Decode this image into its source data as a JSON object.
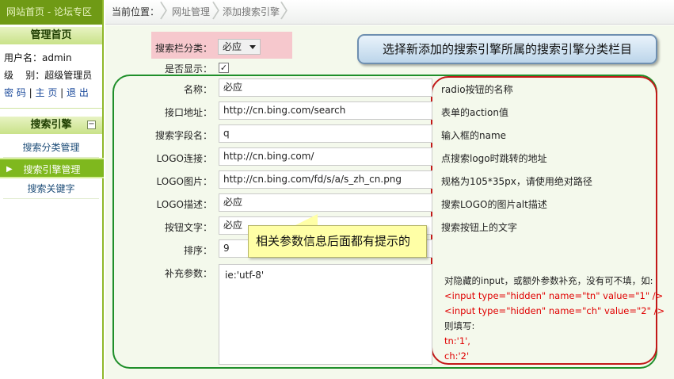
{
  "topnav": {
    "text": "网站首页 - 论坛专区"
  },
  "sidebar": {
    "section1_title": "管理首页",
    "username_label": "用户名：",
    "username": "admin",
    "level_label": "级    别：",
    "level": "超级管理员",
    "link_password": "密 码",
    "link_home": "主 页",
    "link_logout": "退 出",
    "section2_title": "搜索引擎",
    "collapse_icon": "minus-box-icon",
    "items": [
      {
        "label": "搜索分类管理"
      },
      {
        "label": "搜索引擎管理"
      },
      {
        "label": "搜索关键字"
      }
    ]
  },
  "breadcrumb": {
    "current_label": "当前位置：",
    "level1": "网址管理",
    "level2": "添加搜索引擎"
  },
  "form": {
    "category_label": "搜索栏分类：",
    "category_value": "必应",
    "show_label": "是否显示：",
    "show_checked": true,
    "fields": [
      {
        "label": "名称：",
        "value": "必应",
        "hint": "radio按钮的名称"
      },
      {
        "label": "接口地址：",
        "value": "http://cn.bing.com/search",
        "hint": "表单的action值"
      },
      {
        "label": "搜索字段名：",
        "value": "q",
        "hint": "输入框的name"
      },
      {
        "label": "LOGO连接：",
        "value": "http://cn.bing.com/",
        "hint": "点搜索logo时跳转的地址"
      },
      {
        "label": "LOGO图片：",
        "value": "http://cn.bing.com/fd/s/a/s_zh_cn.png",
        "hint": "规格为105*35px，请使用绝对路径"
      },
      {
        "label": "LOGO描述：",
        "value": "必应",
        "hint": "搜索LOGO的图片alt描述"
      },
      {
        "label": "按钮文字：",
        "value": "必应",
        "hint": "搜索按钮上的文字"
      },
      {
        "label": "排序：",
        "value": "9"
      }
    ],
    "extra_label": "补充参数：",
    "extra_value": "ie:'utf-8'",
    "extra_hint": {
      "line1": "对隐藏的input，或额外参数补充，没有可不填，如:",
      "line2": "<input type=\"hidden\" name=\"tn\" value=\"1\" />",
      "line3": "<input type=\"hidden\" name=\"ch\" value=\"2\" />",
      "line4": "则填写:",
      "line5": "tn:'1',",
      "line6": "ch:'2'"
    }
  },
  "annotations": {
    "callout_category": "选择新添加的搜索引擎所属的搜索引擎分类栏目",
    "note_hints": "相关参数信息后面都有提示的"
  }
}
